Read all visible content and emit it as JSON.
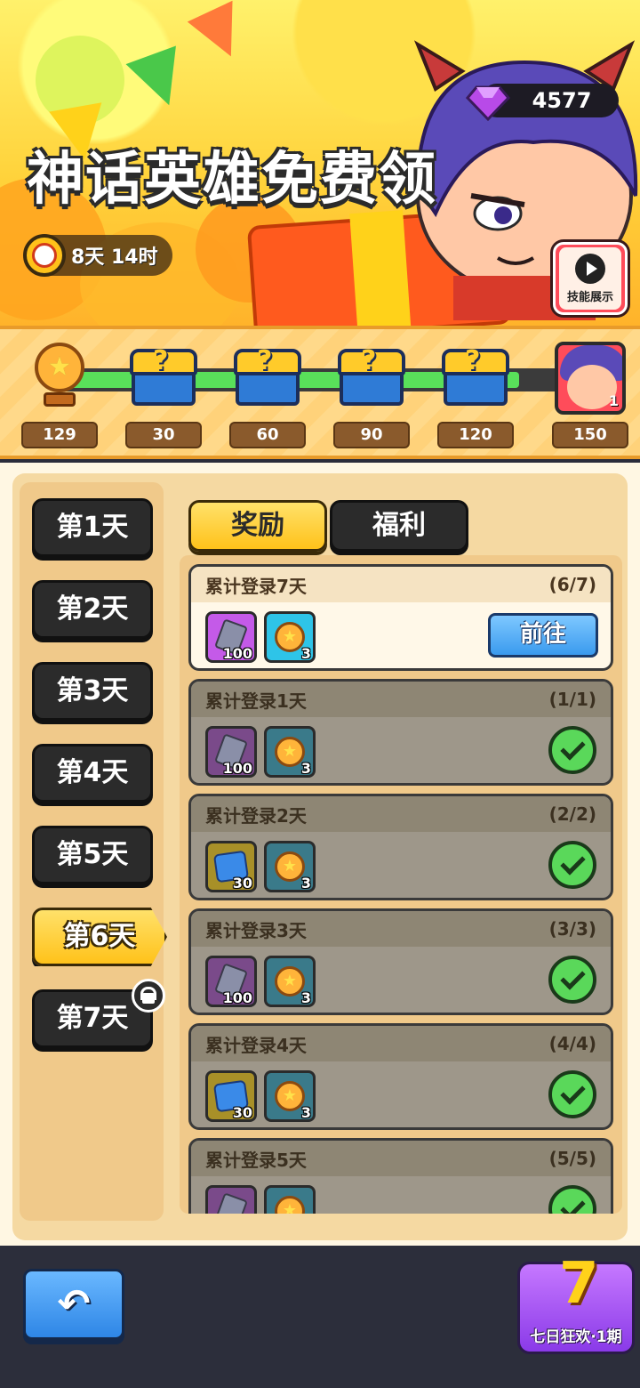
{
  "banner": {
    "title": "神话英雄免费领",
    "timer": "8天 14时",
    "gems": "4577",
    "skill_button": "技能展示"
  },
  "progress": {
    "fill_fraction": 0.92,
    "milestones": [
      {
        "value": "129",
        "icon": "trophy-icon"
      },
      {
        "value": "30",
        "icon": "chest-icon"
      },
      {
        "value": "60",
        "icon": "chest-icon"
      },
      {
        "value": "90",
        "icon": "chest-icon"
      },
      {
        "value": "120",
        "icon": "chest-icon"
      },
      {
        "value": "150",
        "icon": "hero-avatar-icon",
        "count": "1"
      }
    ]
  },
  "days": [
    {
      "label": "第1天",
      "state": "normal"
    },
    {
      "label": "第2天",
      "state": "normal"
    },
    {
      "label": "第3天",
      "state": "normal"
    },
    {
      "label": "第4天",
      "state": "normal"
    },
    {
      "label": "第5天",
      "state": "normal"
    },
    {
      "label": "第6天",
      "state": "active"
    },
    {
      "label": "第7天",
      "state": "locked"
    }
  ],
  "tabs": {
    "rewards": "奖励",
    "welfare": "福利"
  },
  "tasks": [
    {
      "title": "累计登录7天",
      "progress": "(6/7)",
      "status": "go",
      "action": "前往",
      "items": [
        {
          "type": "crystal",
          "qty": "100"
        },
        {
          "type": "trophy",
          "qty": "3"
        }
      ]
    },
    {
      "title": "累计登录1天",
      "progress": "(1/1)",
      "status": "done",
      "items": [
        {
          "type": "crystal",
          "qty": "100"
        },
        {
          "type": "trophy",
          "qty": "3"
        }
      ]
    },
    {
      "title": "累计登录2天",
      "progress": "(2/2)",
      "status": "done",
      "items": [
        {
          "type": "bluegem",
          "qty": "30"
        },
        {
          "type": "trophy",
          "qty": "3"
        }
      ]
    },
    {
      "title": "累计登录3天",
      "progress": "(3/3)",
      "status": "done",
      "items": [
        {
          "type": "crystal",
          "qty": "100"
        },
        {
          "type": "trophy",
          "qty": "3"
        }
      ]
    },
    {
      "title": "累计登录4天",
      "progress": "(4/4)",
      "status": "done",
      "items": [
        {
          "type": "bluegem",
          "qty": "30"
        },
        {
          "type": "trophy",
          "qty": "3"
        }
      ]
    },
    {
      "title": "累计登录5天",
      "progress": "(5/5)",
      "status": "done",
      "items": [
        {
          "type": "crystal",
          "qty": ""
        },
        {
          "type": "trophy",
          "qty": ""
        }
      ]
    }
  ],
  "bottom": {
    "event_label": "七日狂欢·1期",
    "event_number": "7"
  }
}
